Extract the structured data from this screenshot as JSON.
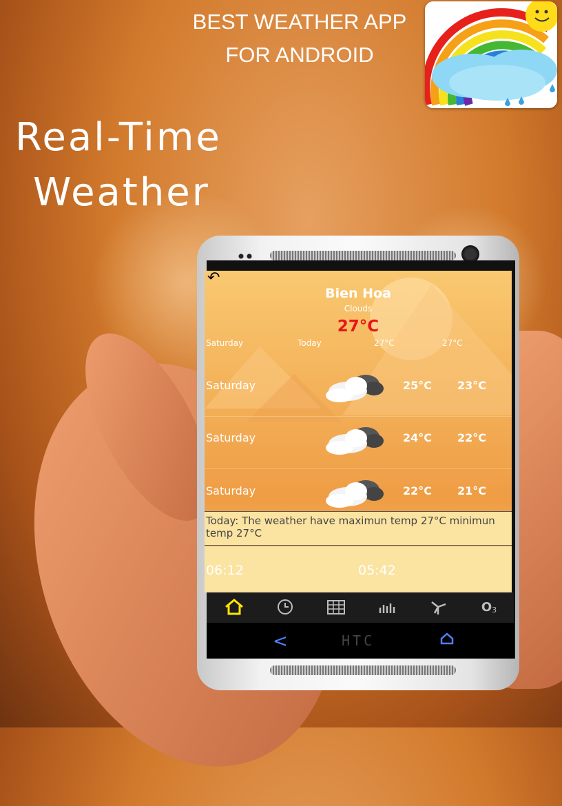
{
  "promo": {
    "line1": "BEST WEATHER  APP",
    "line2": "FOR ANDROID",
    "headline1": "Real-Time",
    "headline2": "Weather"
  },
  "app": {
    "back_icon": "back-arrow-icon",
    "city": "Bien Hoa",
    "condition": "Clouds",
    "current_temp": "27°C",
    "header_row": {
      "day": "Saturday",
      "label": "Today",
      "max": "27°C",
      "min": "27°C"
    },
    "forecast": [
      {
        "day": "Saturday",
        "icon": "cloudy-icon",
        "high": "25°C",
        "low": "23°C"
      },
      {
        "day": "Saturday",
        "icon": "cloudy-icon",
        "high": "24°C",
        "low": "22°C"
      },
      {
        "day": "Saturday",
        "icon": "cloudy-icon",
        "high": "22°C",
        "low": "21°C"
      }
    ],
    "summary": "Today: The weather have maximun temp 27°C minimun temp 27°C",
    "sunrise": "06:12",
    "sunset": "05:42",
    "tabs": [
      "home-icon",
      "clock-icon",
      "calendar-icon",
      "chart-icon",
      "wind-icon",
      "ozone-icon"
    ],
    "ozone_label": "O",
    "ozone_sub": "3",
    "accent": "#ffe600",
    "temp_color": "#e8141a"
  },
  "device": {
    "brand": "HTC",
    "nav_back": "<"
  }
}
